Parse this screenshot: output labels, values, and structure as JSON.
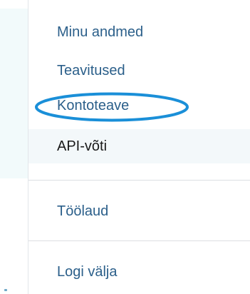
{
  "menu": {
    "items": [
      {
        "label": "Minu andmed"
      },
      {
        "label": "Teavitused"
      },
      {
        "label": "Kontoteave"
      },
      {
        "label": "API-võti"
      }
    ],
    "secondary": [
      {
        "label": "Töölaud"
      }
    ],
    "logout": {
      "label": "Logi välja"
    }
  },
  "annotation": {
    "color": "#1a8fd8"
  }
}
